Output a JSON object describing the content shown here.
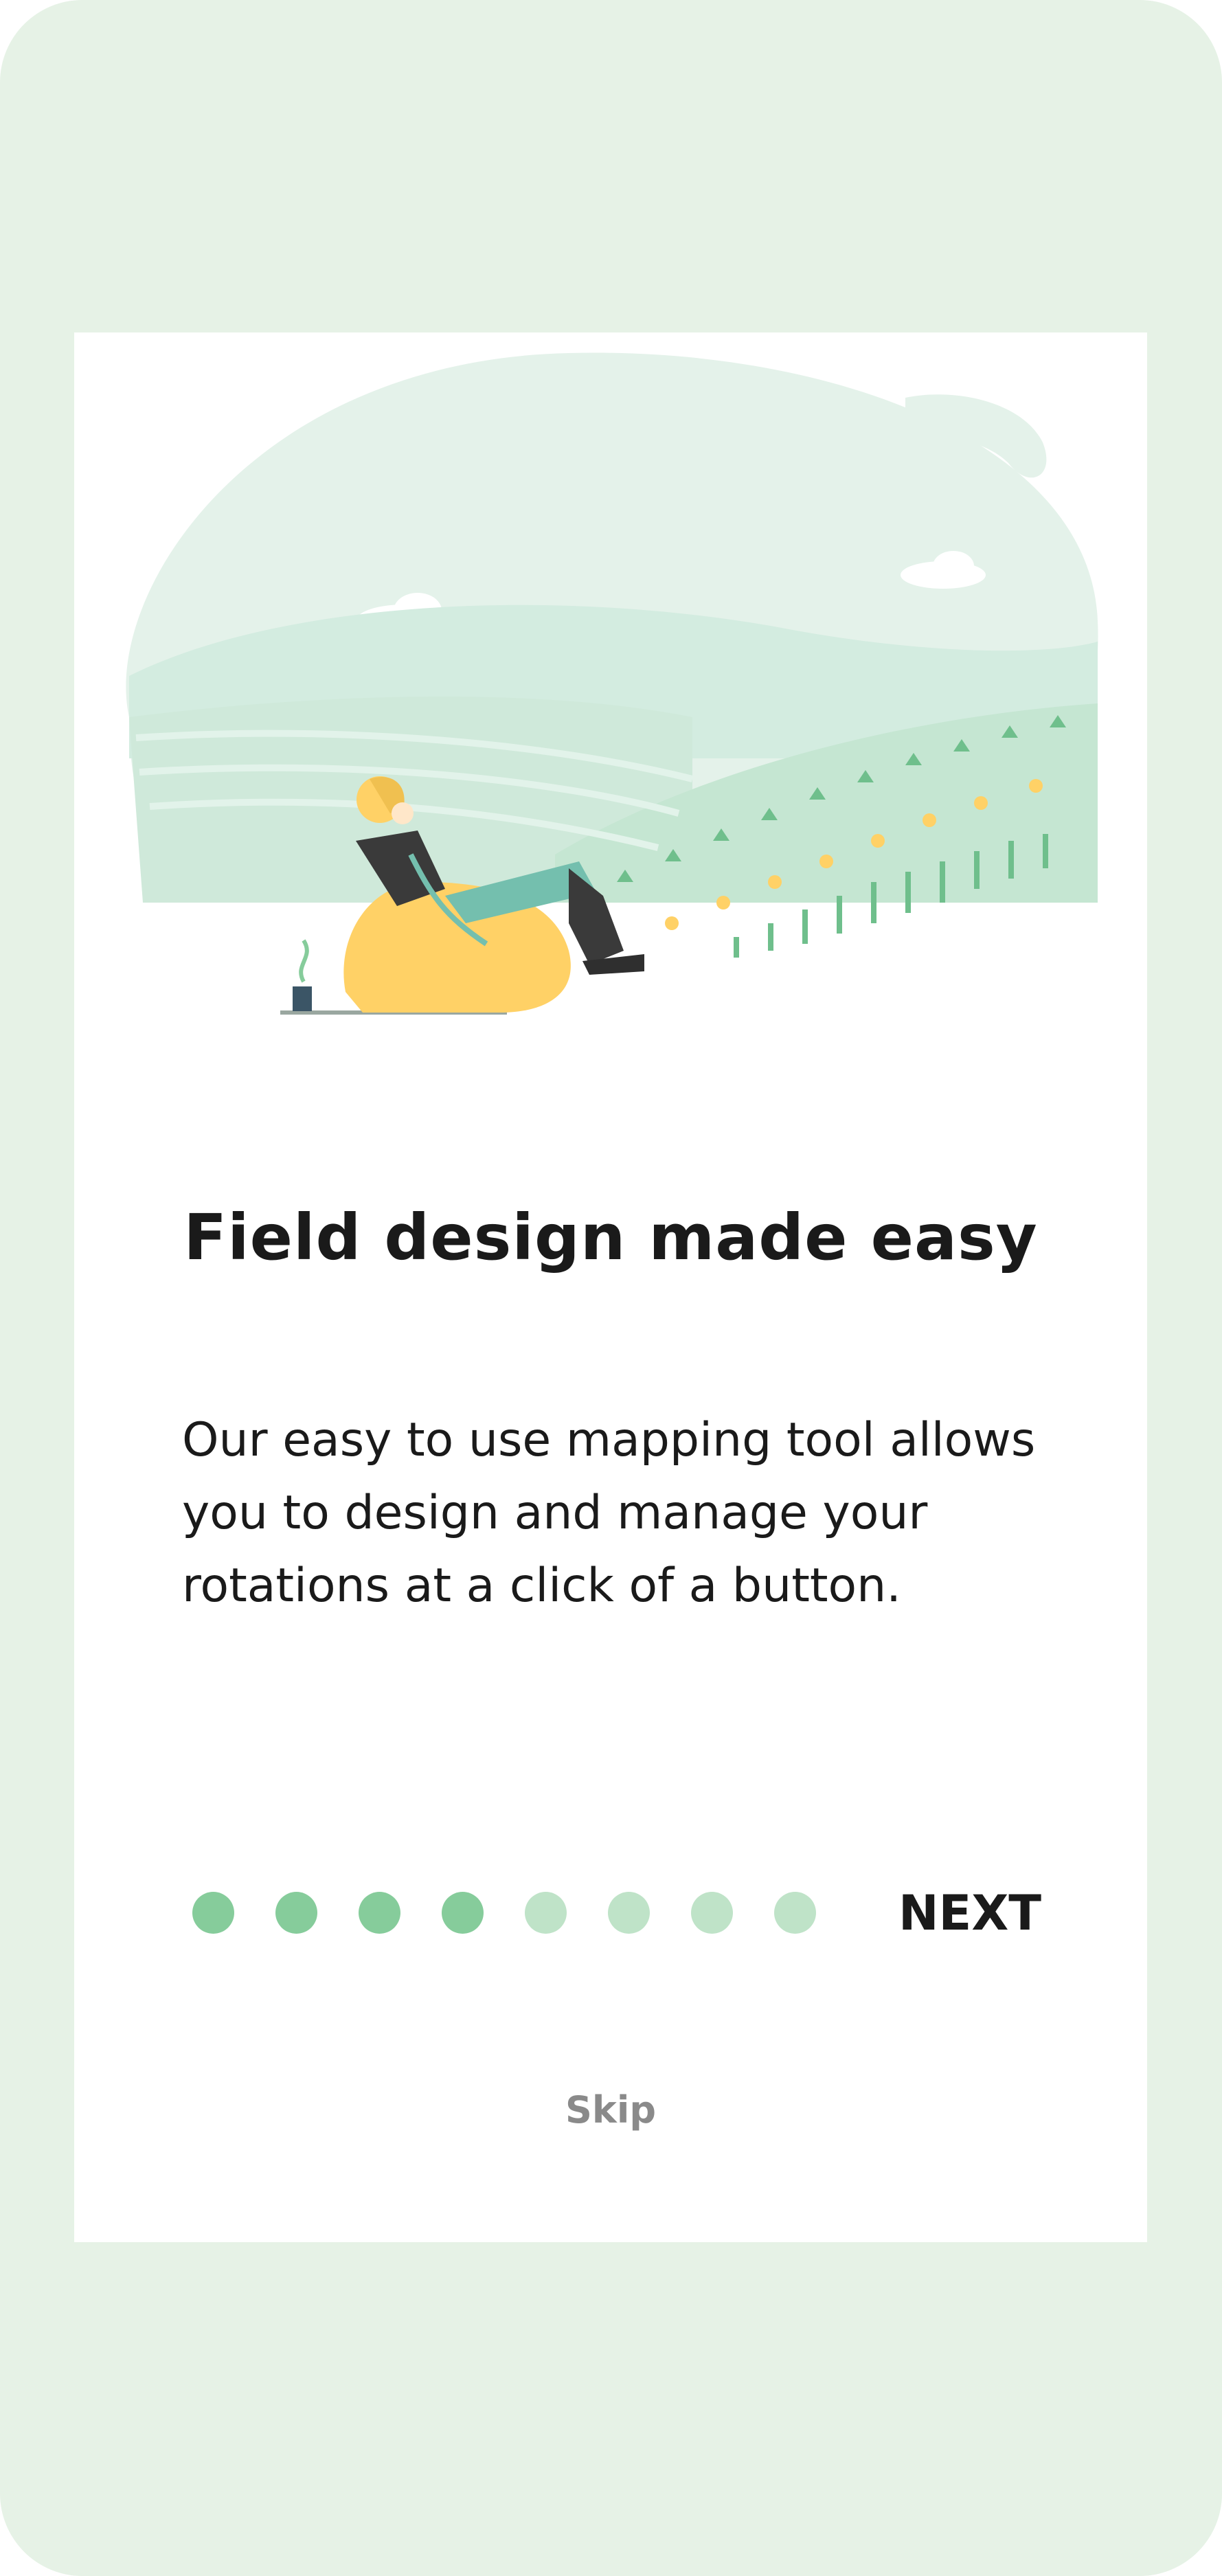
{
  "onboarding": {
    "title": "Field design made easy",
    "description": "Our easy to use mapping tool allows you to design and manage your rotations at a click of a button.",
    "next_label": "NEXT",
    "skip_label": "Skip",
    "pagination": {
      "total": 8,
      "current": 4
    },
    "illustration_icon": "person-relaxing-in-field-illustration"
  },
  "colors": {
    "background": "#e6f2e6",
    "card": "#ffffff",
    "dot_active": "#86cc9b",
    "dot_inactive": "#bfe3c8",
    "text": "#1a1a1a",
    "skip_text": "#8a8a8a",
    "accent_yellow": "#ffd166",
    "accent_teal": "#74bfae"
  }
}
